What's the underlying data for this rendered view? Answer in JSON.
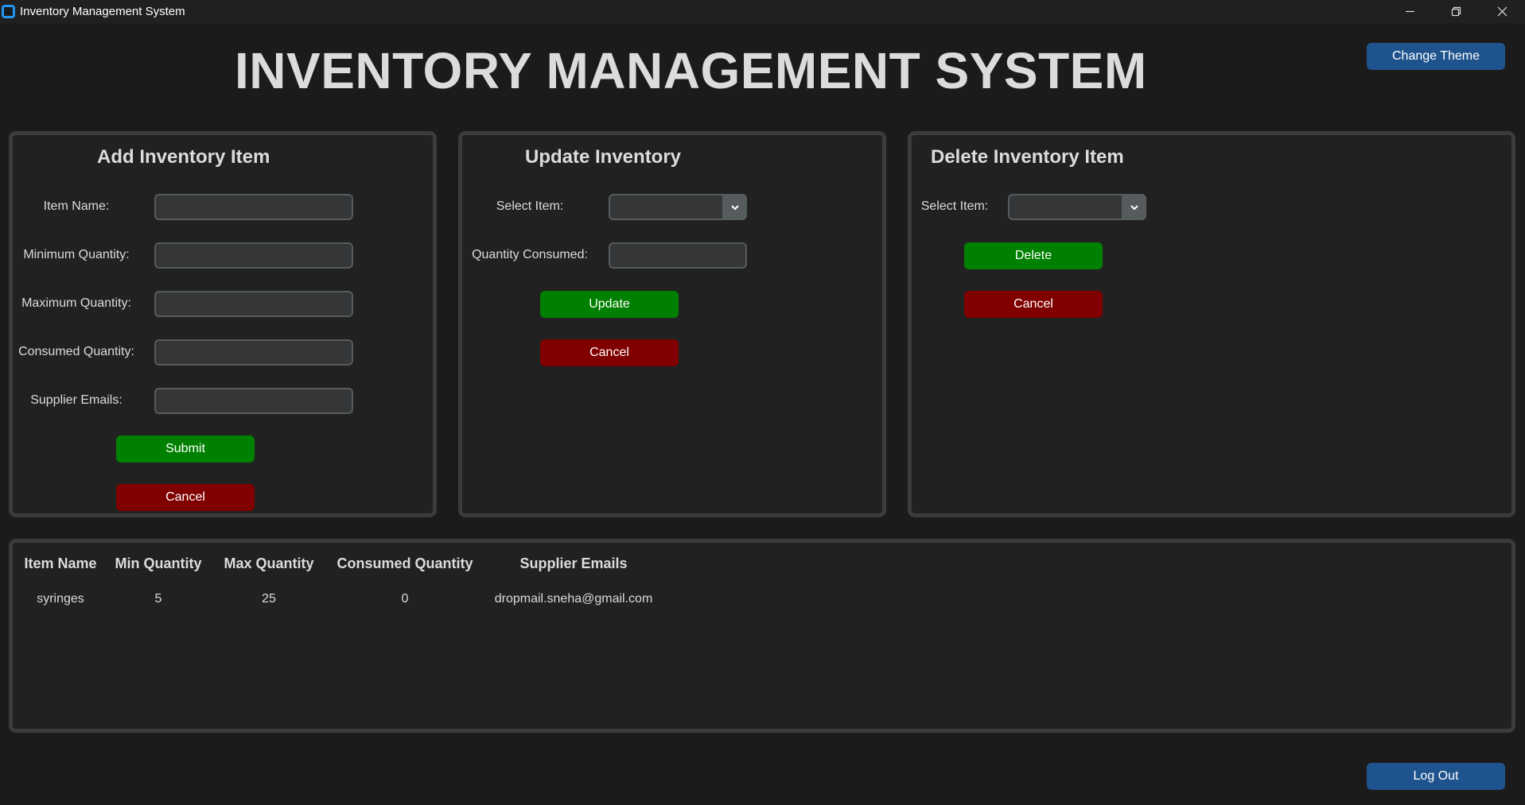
{
  "window": {
    "title": "Inventory Management System",
    "controls": [
      "minimize-icon",
      "restore-icon",
      "close-icon"
    ]
  },
  "header": {
    "title": "INVENTORY MANAGEMENT SYSTEM",
    "change_theme_label": "Change Theme"
  },
  "add_panel": {
    "heading": "Add Inventory Item",
    "fields": [
      {
        "label": "Item Name:",
        "value": ""
      },
      {
        "label": "Minimum Quantity:",
        "value": ""
      },
      {
        "label": "Maximum Quantity:",
        "value": ""
      },
      {
        "label": "Consumed Quantity:",
        "value": ""
      },
      {
        "label": "Supplier Emails:",
        "value": ""
      }
    ],
    "submit_label": "Submit",
    "cancel_label": "Cancel"
  },
  "update_panel": {
    "heading": "Update Inventory",
    "select_label": "Select Item:",
    "select_value": "",
    "quantity_label": "Quantity Consumed:",
    "quantity_value": "",
    "update_label": "Update",
    "cancel_label": "Cancel"
  },
  "delete_panel": {
    "heading": "Delete Inventory Item",
    "select_label": "Select Item:",
    "select_value": "",
    "delete_label": "Delete",
    "cancel_label": "Cancel"
  },
  "table": {
    "columns": [
      "Item Name",
      "Min Quantity",
      "Max Quantity",
      "Consumed Quantity",
      "Supplier Emails"
    ],
    "rows": [
      [
        "syringes",
        "5",
        "25",
        "0",
        "dropmail.sneha@gmail.com"
      ]
    ]
  },
  "footer": {
    "logout_label": "Log Out"
  },
  "colors": {
    "background": "#1b1b1b",
    "panel": "#212121",
    "panel_border": "#3c3c3c",
    "accent_blue": "#1f538d",
    "confirm_green": "#008000",
    "cancel_red": "#800000"
  }
}
